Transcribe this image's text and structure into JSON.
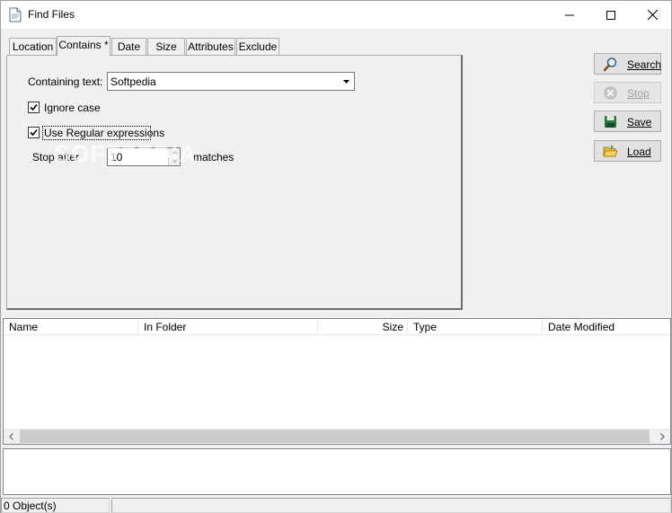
{
  "window": {
    "title": "Find Files"
  },
  "tabs": [
    {
      "label": "Location"
    },
    {
      "label": "Contains *"
    },
    {
      "label": "Date"
    },
    {
      "label": "Size"
    },
    {
      "label": "Attributes"
    },
    {
      "label": "Exclude"
    }
  ],
  "contains": {
    "containing_text_label": "Containing text:",
    "containing_text_value": "Softpedia",
    "ignore_case_label": "Ignore case",
    "ignore_case_checked": true,
    "regex_label": "Use Regular expressions",
    "regex_checked": true,
    "stop_after_label": "Stop after",
    "stop_after_value": "10",
    "matches_label": "matches"
  },
  "watermark": "SOFTPEDIA",
  "actions": {
    "search_label": "Search",
    "stop_label": "Stop",
    "save_label": "Save",
    "load_label": "Load"
  },
  "results": {
    "columns": [
      {
        "label": "Name"
      },
      {
        "label": "In Folder"
      },
      {
        "label": "Size"
      },
      {
        "label": "Type"
      },
      {
        "label": "Date Modified"
      }
    ]
  },
  "status": {
    "objects": "0 Object(s)"
  }
}
